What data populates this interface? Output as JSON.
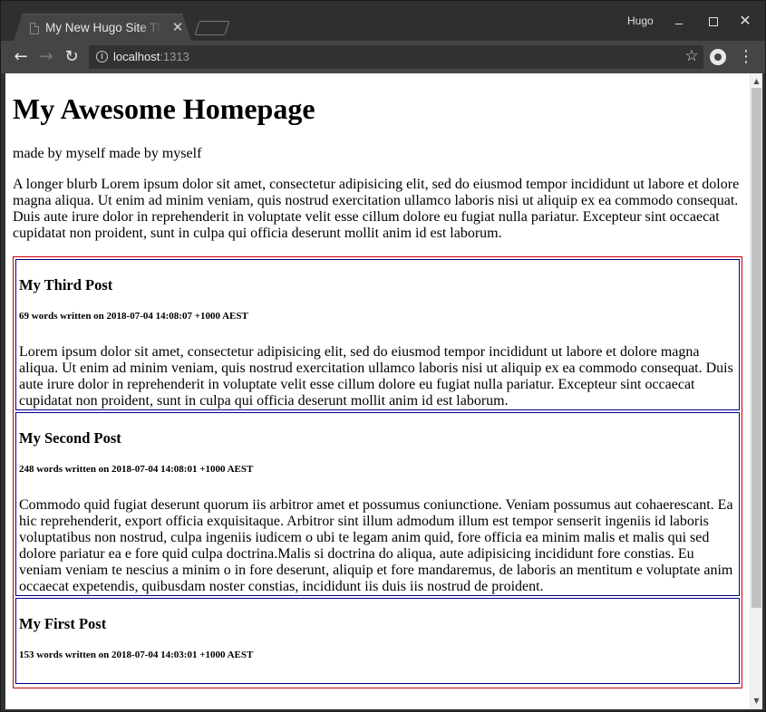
{
  "browser": {
    "tab_title": "My New Hugo Site Theme",
    "tab_close": "✕",
    "profile_name": "Hugo",
    "close_glyph": "✕",
    "url_host": "localhost",
    "url_port": ":1313",
    "info_glyph": "i",
    "star_glyph": "☆",
    "back_glyph": "←",
    "forward_glyph": "→",
    "reload_glyph": "↻",
    "menu_glyph": "⋮",
    "scroll_up_glyph": "▲",
    "scroll_down_glyph": "▼",
    "icons": {
      "tab": "page-icon",
      "back": "arrow-left-icon",
      "forward": "arrow-right-icon",
      "reload": "reload-icon",
      "info": "info-icon",
      "bookmark": "star-icon",
      "extension": "extension-icon",
      "menu": "kebab-menu-icon"
    }
  },
  "page": {
    "title": "My Awesome Homepage",
    "subtitle": "made by myself made by myself",
    "blurb": "A longer blurb Lorem ipsum dolor sit amet, consectetur adipisicing elit, sed do eiusmod tempor incididunt ut labore et dolore magna aliqua. Ut enim ad minim veniam, quis nostrud exercitation ullamco laboris nisi ut aliquip ex ea commodo consequat. Duis aute irure dolor in reprehenderit in voluptate velit esse cillum dolore eu fugiat nulla pariatur. Excepteur sint occaecat cupidatat non proident, sunt in culpa qui officia deserunt mollit anim id est laborum."
  },
  "posts": [
    {
      "title": "My Third Post",
      "meta": "69 words written on 2018-07-04 14:08:07 +1000 AEST",
      "summary": "Lorem ipsum dolor sit amet, consectetur adipisicing elit, sed do eiusmod tempor incididunt ut labore et dolore magna aliqua. Ut enim ad minim veniam, quis nostrud exercitation ullamco laboris nisi ut aliquip ex ea commodo consequat. Duis aute irure dolor in reprehenderit in voluptate velit esse cillum dolore eu fugiat nulla pariatur. Excepteur sint occaecat cupidatat non proident, sunt in culpa qui officia deserunt mollit anim id est laborum."
    },
    {
      "title": "My Second Post",
      "meta": "248 words written on 2018-07-04 14:08:01 +1000 AEST",
      "summary": "Commodo quid fugiat deserunt quorum iis arbitror amet et possumus coniunctione. Veniam possumus aut cohaerescant. Ea hic reprehenderit, export officia exquisitaque. Arbitror sint illum admodum illum est tempor senserit ingeniis id laboris voluptatibus non nostrud, culpa ingeniis iudicem o ubi te legam anim quid, fore officia ea minim malis et malis qui sed dolore pariatur ea e fore quid culpa doctrina.Malis si doctrina do aliqua, aute adipisicing incididunt fore constias. Eu veniam veniam te nescius a minim o in fore deserunt, aliquip et fore mandaremus, de laboris an mentitum e voluptate anim occaecat expetendis, quibusdam noster constias, incididunt iis duis iis nostrud de proident."
    },
    {
      "title": "My First Post",
      "meta": "153 words written on 2018-07-04 14:03:01 +1000 AEST",
      "summary": ""
    }
  ],
  "colors": {
    "posts_border": "#cc0000",
    "post_border": "#00008b"
  }
}
